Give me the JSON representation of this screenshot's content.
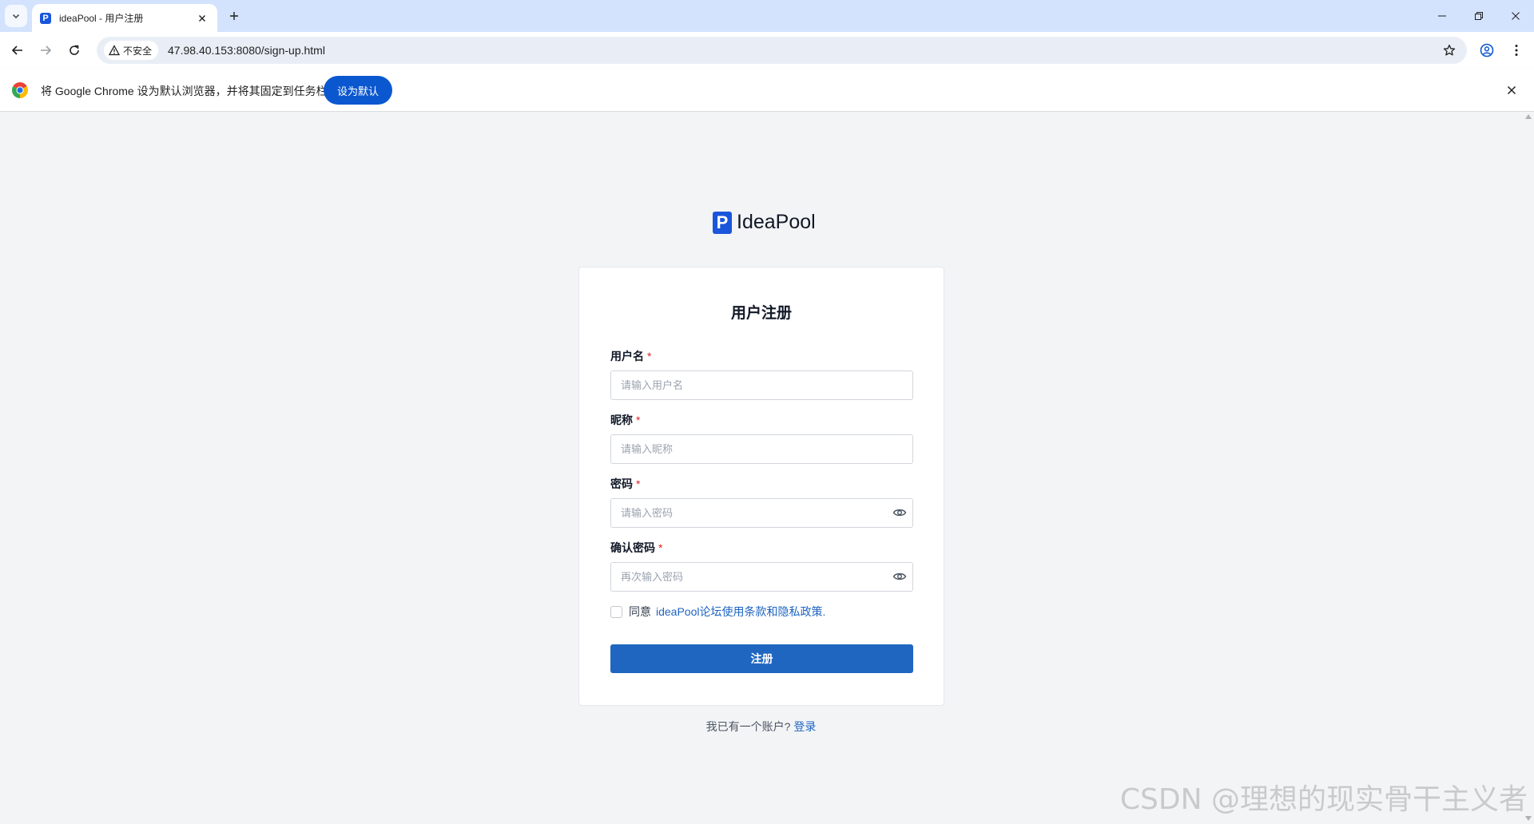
{
  "browser": {
    "tab_title": "ideaPool - 用户注册",
    "tab_favicon_letter": "P",
    "security_label": "不安全",
    "url": "47.98.40.153:8080/sign-up.html"
  },
  "infobar": {
    "message": "将 Google Chrome 设为默认浏览器，并将其固定到任务栏",
    "button_label": "设为默认"
  },
  "brand": {
    "logo_letter": "P",
    "name": "IdeaPool"
  },
  "form": {
    "title": "用户注册",
    "fields": [
      {
        "label": "用户名",
        "required_mark": "*",
        "placeholder": "请输入用户名"
      },
      {
        "label": "昵称",
        "required_mark": "*",
        "placeholder": "请输入昵称"
      },
      {
        "label": "密码",
        "required_mark": "*",
        "placeholder": "请输入密码"
      },
      {
        "label": "确认密码",
        "required_mark": "*",
        "placeholder": "再次输入密码"
      }
    ],
    "agree_prefix": "同意",
    "agree_link": "ideaPool论坛使用条款和隐私政策.",
    "submit_label": "注册"
  },
  "footer": {
    "prompt": "我已有一个账户?",
    "login_link": "登录"
  },
  "watermark": "CSDN @理想的现实骨干主义者",
  "colors": {
    "primary": "#1f66c1",
    "link": "#1d64c2",
    "required": "#dc2626",
    "brand": "#1a56db",
    "page_bg": "#f3f4f6"
  }
}
